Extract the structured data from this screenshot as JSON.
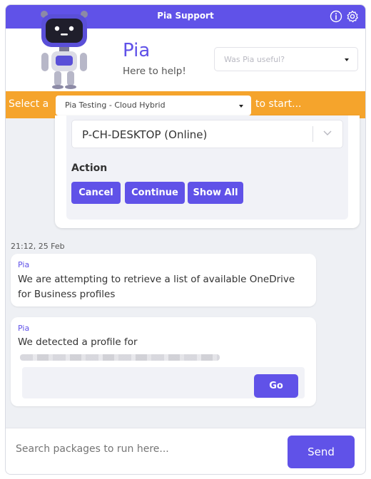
{
  "window": {
    "title": "Pia Support"
  },
  "header": {
    "name": "Pia",
    "tagline": "Here to help!",
    "feedback_select": {
      "value": "Was Pia useful?"
    }
  },
  "selector": {
    "prefix": "Select a",
    "value": "Pia Testing - Cloud Hybrid",
    "suffix": "to start..."
  },
  "action_card": {
    "device": "P-CH-DESKTOP (Online)",
    "label": "Action",
    "buttons": [
      "Cancel",
      "Continue",
      "Show All"
    ]
  },
  "messages": {
    "timestamp": "21:12, 25 Feb",
    "items": [
      {
        "sender": "Pia",
        "text": "We are attempting to retrieve a list of available OneDrive for Business profiles"
      },
      {
        "sender": "Pia",
        "text": "We detected a profile for",
        "button": "Go"
      }
    ]
  },
  "composer": {
    "placeholder": "Search packages to run here...",
    "send_label": "Send"
  },
  "colors": {
    "accent": "#6052e8",
    "orange": "#f5a42c"
  }
}
